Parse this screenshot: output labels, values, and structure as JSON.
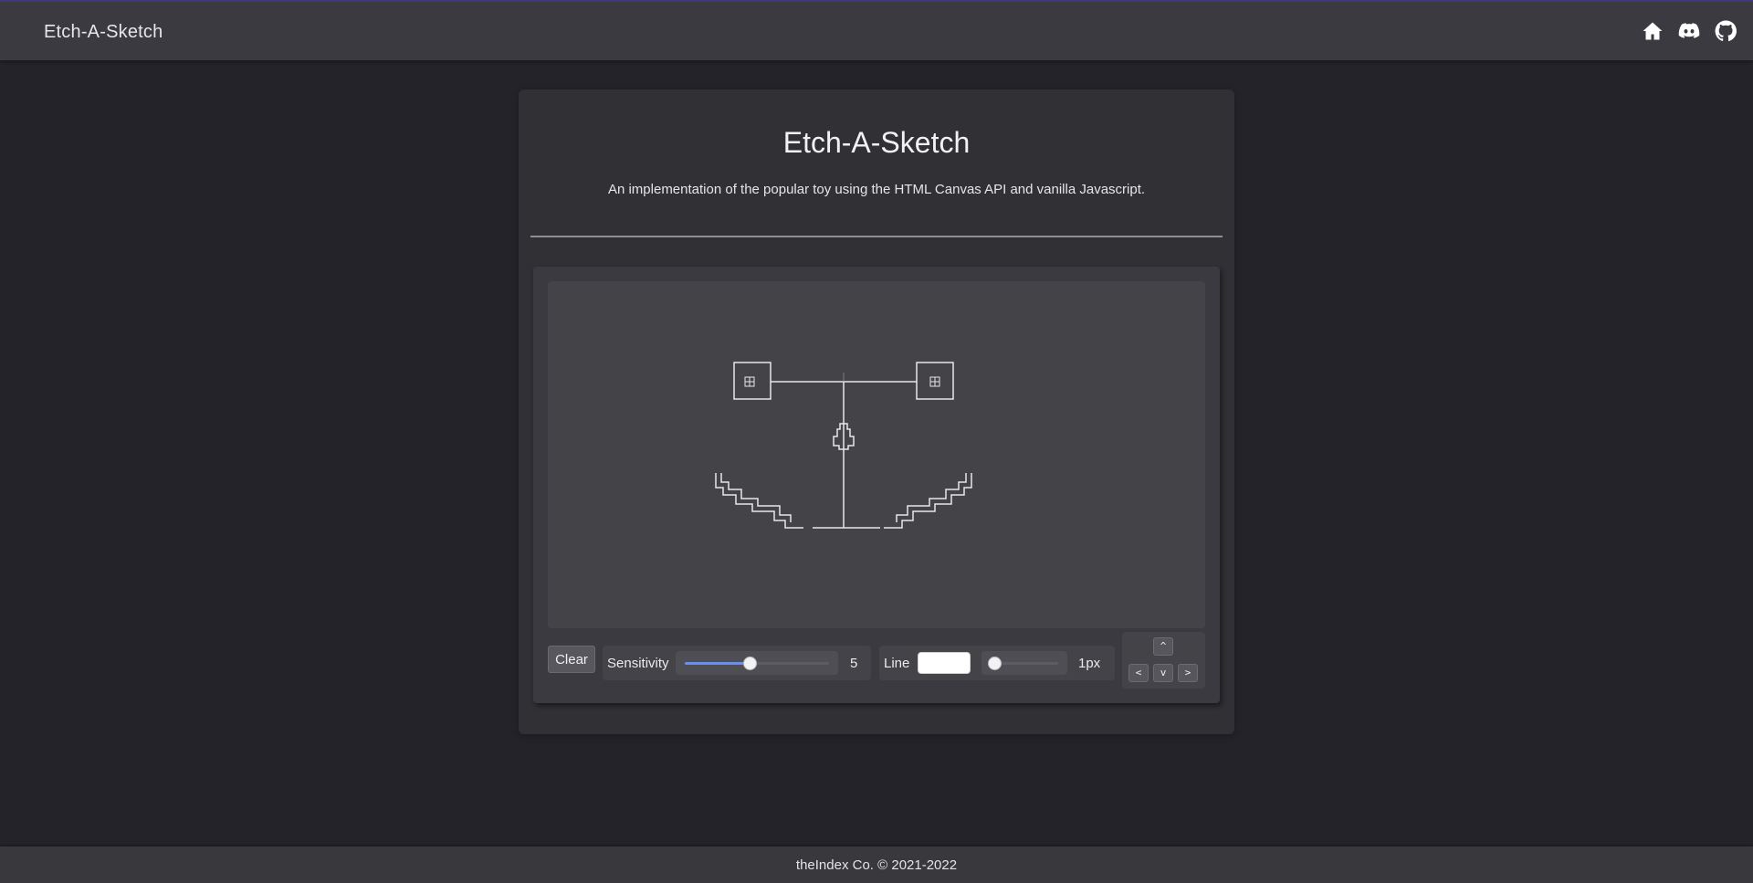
{
  "header": {
    "brand": "Etch-A-Sketch",
    "icons": [
      "home-icon",
      "discord-icon",
      "github-icon"
    ]
  },
  "card": {
    "title": "Etch-A-Sketch",
    "subtitle": "An implementation of the popular toy using the HTML Canvas API and vanilla Javascript."
  },
  "controls": {
    "clear_label": "Clear",
    "sensitivity_label": "Sensitivity",
    "sensitivity_value": "5",
    "sensitivity_fraction": 0.45,
    "line_label": "Line",
    "line_color": "#ffffff",
    "line_width_value": "1px",
    "line_width_fraction": 0.0,
    "dpad": {
      "up": "^",
      "left": "<",
      "down": "v",
      "right": ">"
    }
  },
  "footer": {
    "text": "theIndex Co. © 2021-2022"
  },
  "colors": {
    "background": "#242329",
    "topbar": "#3a3a40",
    "card": "#303035",
    "canvas": "#434348",
    "accent": "#6a8ef0"
  }
}
